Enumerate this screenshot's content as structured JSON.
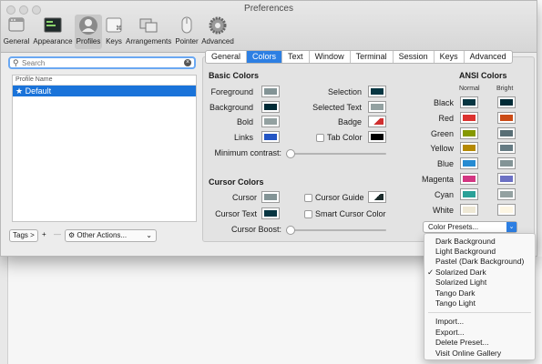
{
  "window": {
    "title": "Preferences"
  },
  "toolbar": {
    "items": [
      {
        "label": "General",
        "icon": "general-icon"
      },
      {
        "label": "Appearance",
        "icon": "appearance-icon"
      },
      {
        "label": "Profiles",
        "icon": "profiles-icon",
        "selected": true
      },
      {
        "label": "Keys",
        "icon": "keys-icon"
      },
      {
        "label": "Arrangements",
        "icon": "arrangements-icon"
      },
      {
        "label": "Pointer",
        "icon": "pointer-icon"
      },
      {
        "label": "Advanced",
        "icon": "advanced-icon"
      }
    ]
  },
  "profiles": {
    "search_placeholder": "Search",
    "column_header": "Profile Name",
    "items": [
      {
        "label": "★ Default",
        "selected": true
      }
    ],
    "tags_label": "Tags >",
    "add_label": "+",
    "remove_label": "—",
    "other_actions_label": "Other Actions..."
  },
  "tabs": [
    {
      "label": "General"
    },
    {
      "label": "Colors",
      "selected": true
    },
    {
      "label": "Text"
    },
    {
      "label": "Window"
    },
    {
      "label": "Terminal"
    },
    {
      "label": "Session"
    },
    {
      "label": "Keys"
    },
    {
      "label": "Advanced"
    }
  ],
  "basic_colors": {
    "title": "Basic Colors",
    "foreground": {
      "label": "Foreground",
      "color": "#839496"
    },
    "background": {
      "label": "Background",
      "color": "#002b36"
    },
    "bold": {
      "label": "Bold",
      "color": "#93a1a1"
    },
    "links": {
      "label": "Links",
      "color": "#2355c4"
    },
    "selection": {
      "label": "Selection",
      "color": "#073642"
    },
    "selected_text": {
      "label": "Selected Text",
      "color": "#93a1a1"
    },
    "badge": {
      "label": "Badge",
      "color": "#d02f2f"
    },
    "tab_color": {
      "label": "Tab Color",
      "color": "#000000"
    },
    "min_contrast": {
      "label": "Minimum contrast:",
      "value": 0
    }
  },
  "cursor_colors": {
    "title": "Cursor Colors",
    "cursor": {
      "label": "Cursor",
      "color": "#839496"
    },
    "cursor_text": {
      "label": "Cursor Text",
      "color": "#073642"
    },
    "cursor_guide": {
      "label": "Cursor Guide",
      "color": "#b3ecff"
    },
    "smart_cursor": {
      "label": "Smart Cursor Color"
    },
    "boost": {
      "label": "Cursor Boost:",
      "value": 0
    }
  },
  "ansi": {
    "title": "ANSI Colors",
    "normal_header": "Normal",
    "bright_header": "Bright",
    "rows": [
      {
        "label": "Black",
        "normal": "#073642",
        "bright": "#002b36"
      },
      {
        "label": "Red",
        "normal": "#dc322f",
        "bright": "#cb4b16"
      },
      {
        "label": "Green",
        "normal": "#859900",
        "bright": "#586e75"
      },
      {
        "label": "Yellow",
        "normal": "#b58900",
        "bright": "#657b83"
      },
      {
        "label": "Blue",
        "normal": "#268bd2",
        "bright": "#839496"
      },
      {
        "label": "Magenta",
        "normal": "#d33682",
        "bright": "#6c71c4"
      },
      {
        "label": "Cyan",
        "normal": "#2aa198",
        "bright": "#93a1a1"
      },
      {
        "label": "White",
        "normal": "#eee8d5",
        "bright": "#fdf6e3"
      }
    ]
  },
  "color_presets": {
    "label": "Color Presets...",
    "menu": {
      "group1": [
        {
          "label": "Dark Background"
        },
        {
          "label": "Light Background"
        },
        {
          "label": "Pastel (Dark Background)"
        },
        {
          "label": "Solarized Dark",
          "checked": true,
          "check_mark": "✓"
        },
        {
          "label": "Solarized Light"
        },
        {
          "label": "Tango Dark"
        },
        {
          "label": "Tango Light"
        }
      ],
      "group2": [
        {
          "label": "Import..."
        },
        {
          "label": "Export..."
        },
        {
          "label": "Delete Preset..."
        },
        {
          "label": "Visit Online Gallery"
        }
      ]
    }
  }
}
